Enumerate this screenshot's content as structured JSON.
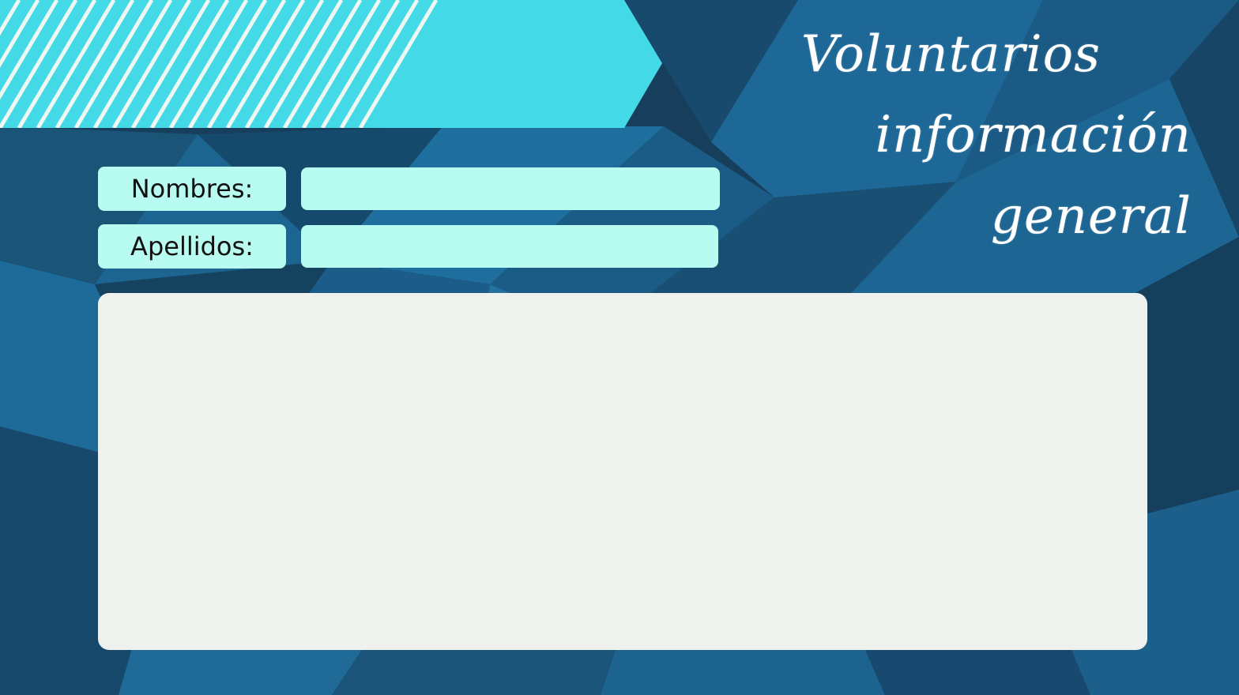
{
  "header": {
    "title_line1": "Voluntarios",
    "title_line2": "información general"
  },
  "form": {
    "nombres_label": "Nombres:",
    "nombres_value": "",
    "apellidos_label": "Apellidos:",
    "apellidos_value": "",
    "notes_value": ""
  },
  "colors": {
    "background": "#173f5c",
    "banner": "#44d9e6",
    "field": "#b7fbf1",
    "panel": "#eff1ee",
    "title_text": "#ffffff"
  },
  "icons": {
    "banner_pattern": "diagonal-stripes"
  }
}
